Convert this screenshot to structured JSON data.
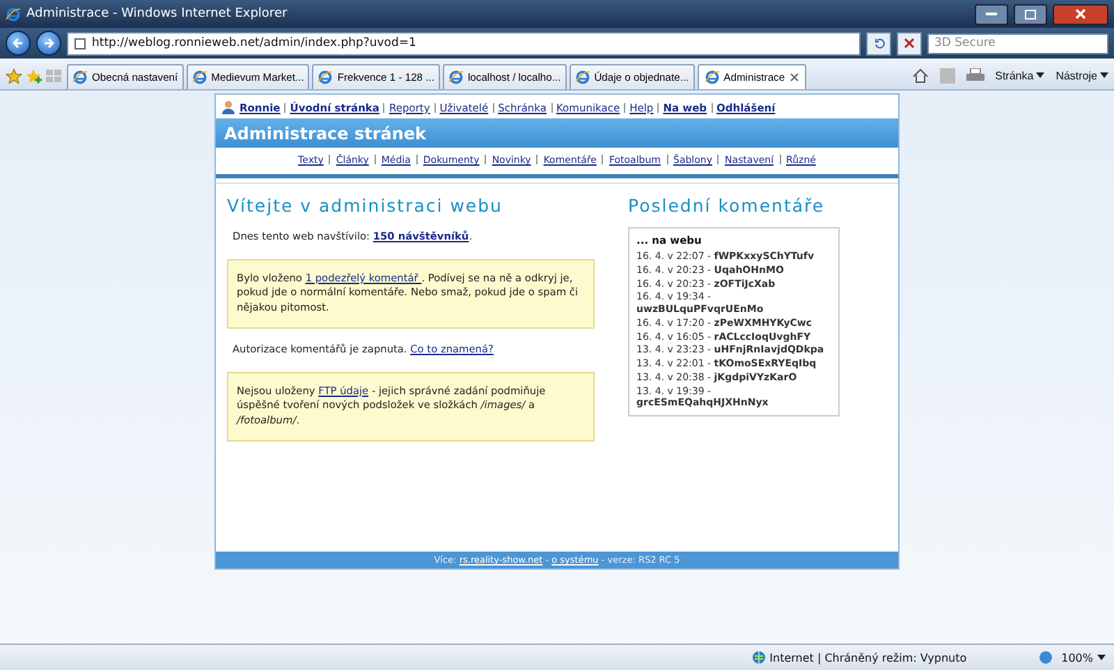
{
  "window": {
    "title": "Administrace - Windows Internet Explorer"
  },
  "address_bar": {
    "url": "http://weblog.ronnieweb.net/admin/index.php?uvod=1"
  },
  "search": {
    "placeholder": "3D Secure"
  },
  "tabs": [
    {
      "label": "Obecná nastavení",
      "selected": false
    },
    {
      "label": "Medievum Market...",
      "selected": false
    },
    {
      "label": "Frekvence 1 - 128 ...",
      "selected": false
    },
    {
      "label": "localhost / localho...",
      "selected": false
    },
    {
      "label": "Údaje o objednate...",
      "selected": false
    },
    {
      "label": "Administrace",
      "selected": true
    }
  ],
  "toolbar": {
    "page_menu": "Stránka",
    "tools_menu": "Nástroje"
  },
  "page": {
    "user_nav": [
      {
        "label": "Ronnie",
        "emphasized": true
      },
      {
        "label": "Úvodní stránka",
        "emphasized": true
      },
      {
        "label": "Reporty",
        "emphasized": false
      },
      {
        "label": "Uživatelé",
        "emphasized": false
      },
      {
        "label": "Schránka",
        "emphasized": false
      },
      {
        "label": "Komunikace",
        "emphasized": false
      },
      {
        "label": "Help",
        "emphasized": false
      },
      {
        "label": "Na web",
        "emphasized": true
      },
      {
        "label": "Odhlášení",
        "emphasized": true
      }
    ],
    "header_title": "Administrace stránek",
    "section_nav": [
      "Texty",
      "Články",
      "Média",
      "Dokumenty",
      "Novinky",
      "Komentáře",
      "Fotoalbum",
      "Šablony",
      "Nastavení",
      "Různé"
    ],
    "welcome_heading": "Vítejte v administraci webu",
    "paragraphs": [
      {
        "boxed": false,
        "segments": [
          {
            "kind": "text",
            "text": "Dnes tento web navštívilo: "
          },
          {
            "kind": "strong_link",
            "text": "150 návštěvníků"
          },
          {
            "kind": "text",
            "text": "."
          }
        ]
      },
      {
        "boxed": true,
        "segments": [
          {
            "kind": "text",
            "text": "Bylo vloženo "
          },
          {
            "kind": "link",
            "text": "1 podezřelý komentář "
          },
          {
            "kind": "text",
            "text": ". Podívej se na ně a odkryj je, pokud jde o normální komentáře. Nebo smaž, pokud jde o spam či nějakou pitomost."
          }
        ]
      },
      {
        "boxed": false,
        "segments": [
          {
            "kind": "text",
            "text": "Autorizace komentářů je zapnuta. "
          },
          {
            "kind": "link",
            "text": "Co to znamená?"
          }
        ]
      },
      {
        "boxed": true,
        "segments": [
          {
            "kind": "text",
            "text": "Nejsou uloženy "
          },
          {
            "kind": "link",
            "text": "FTP údaje"
          },
          {
            "kind": "text",
            "text": " - jejich správné zadání podmiňuje úspěšné tvoření nových podsložek ve složkách "
          },
          {
            "kind": "italic",
            "text": "/images/"
          },
          {
            "kind": "text",
            "text": " a "
          },
          {
            "kind": "italic",
            "text": "/fotoalbum/"
          },
          {
            "kind": "text",
            "text": "."
          }
        ]
      }
    ],
    "comments_heading": "Poslední komentáře",
    "comments_box_title": "... na webu",
    "comments": [
      {
        "date": "16. 4. v 22:07 - ",
        "author": "fWPKxxySChYTufv"
      },
      {
        "date": "16. 4. v 20:23 - ",
        "author": "UqahOHnMO"
      },
      {
        "date": "16. 4. v 20:23 - ",
        "author": "zOFTiJcXab"
      },
      {
        "date": "16. 4. v 19:34 - ",
        "author": "uwzBULquPFvqrUEnMo"
      },
      {
        "date": "16. 4. v 17:20 - ",
        "author": "zPeWXMHYKyCwc"
      },
      {
        "date": "16. 4. v 16:05 - ",
        "author": "rACLccIoqUvghFY"
      },
      {
        "date": "13. 4. v 23:23 - ",
        "author": "uHFnjRnIavjdQDkpa"
      },
      {
        "date": "13. 4. v 22:01 - ",
        "author": "tKOmoSExRYEqIbq"
      },
      {
        "date": "13. 4. v 20:38 - ",
        "author": "jKgdpiVYzKarO"
      },
      {
        "date": "13. 4. v 19:39 - ",
        "author": "grcESmEQahqHJXHnNyx"
      }
    ],
    "footer": [
      {
        "kind": "text",
        "text": "Více: "
      },
      {
        "kind": "link",
        "text": "rs.reality-show.net"
      },
      {
        "kind": "text",
        "text": " - "
      },
      {
        "kind": "link",
        "text": "o systému"
      },
      {
        "kind": "text",
        "text": " - verze: RS2 RC 5"
      }
    ]
  },
  "status_bar": {
    "zone": "Internet | Chráněný režim: Vypnuto",
    "zoom": "100%"
  }
}
